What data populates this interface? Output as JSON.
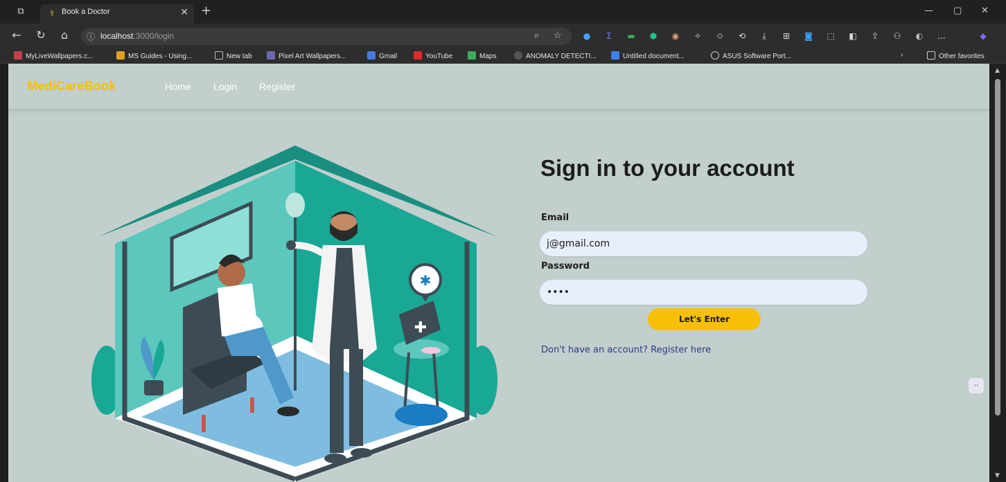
{
  "browser": {
    "tab_title": "Book a Doctor",
    "url_host": "localhost",
    "url_path": ":3000/login",
    "bookmarks": [
      "MyLiveWallpapers.c...",
      "MS Guides - Using...",
      "New tab",
      "Pixel Art Wallpapers...",
      "Gmail",
      "YouTube",
      "Maps",
      "ANOMALY DETECTI...",
      "Untitled document...",
      "ASUS Software Port..."
    ],
    "other_favorites": "Other favorites",
    "more_label": "..."
  },
  "nav": {
    "brand": "MediCareBook",
    "links": [
      "Home",
      "Login",
      "Register"
    ]
  },
  "form": {
    "heading": "Sign in to your account",
    "email_label": "Email",
    "email_value": "j@gmail.com",
    "password_label": "Password",
    "password_value": "••••",
    "submit_label": "Let's Enter",
    "register_link": "Don't have an account? Register here"
  },
  "colors": {
    "brand": "#f6c000",
    "button": "#f8bf08",
    "page_bg": "#c2cfcd",
    "input_bg": "#e8effc",
    "teal": "#1aa896"
  }
}
